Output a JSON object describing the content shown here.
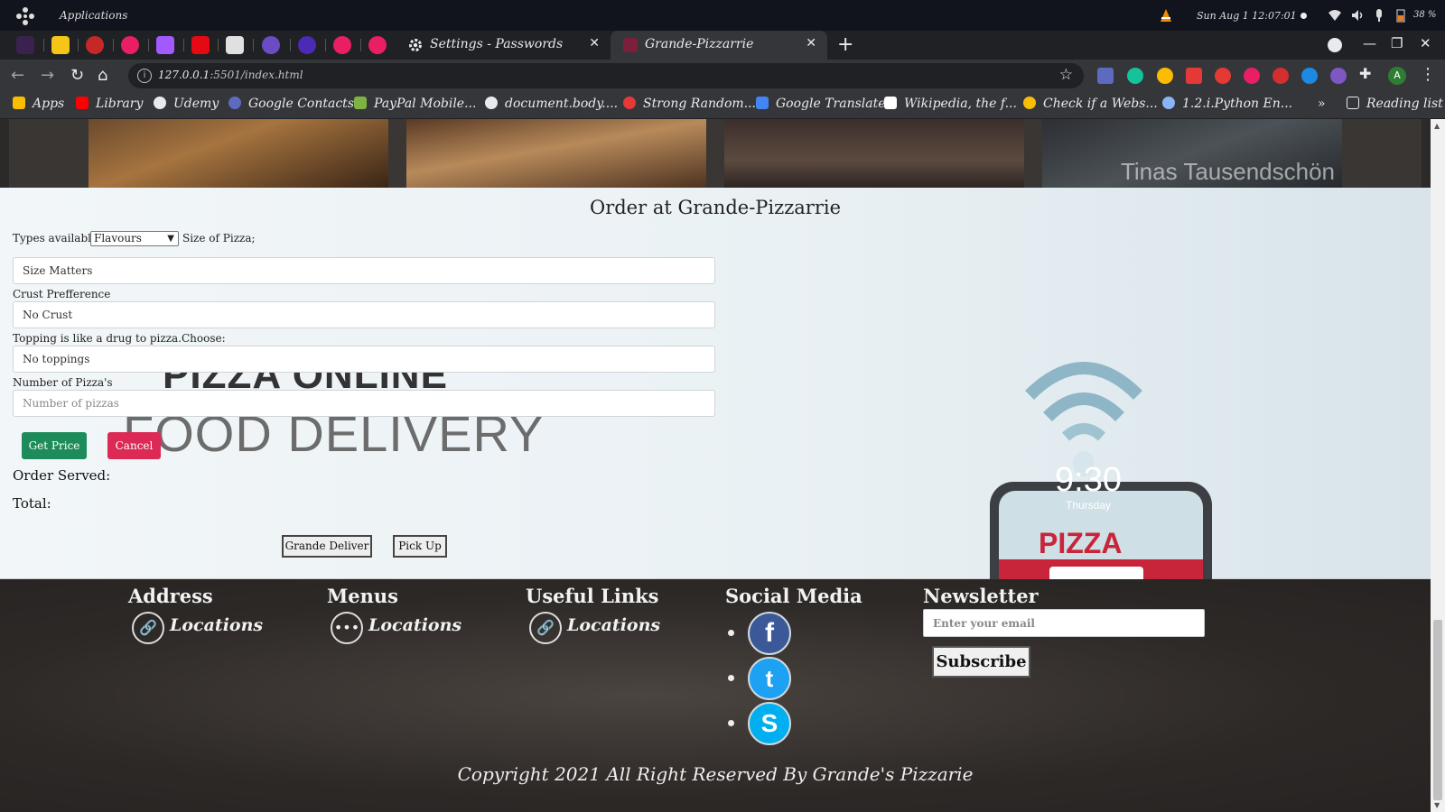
{
  "os": {
    "applications_label": "Applications",
    "clock": "Sun Aug 1  12:07:01",
    "battery_pct": "38 %"
  },
  "browser": {
    "tabs": [
      {
        "title": "Settings - Passwords",
        "icon": "gear-icon"
      },
      {
        "title": "Grande-Pizzarrie",
        "icon": "site-favicon"
      }
    ],
    "url_host": "127.0.0.1",
    "url_path": ":5501/index.html",
    "profile_initial": "A",
    "bookmarks": [
      {
        "label": "Apps",
        "color": "#fbbc04"
      },
      {
        "label": "Library",
        "color": "#ff0000"
      },
      {
        "label": "Udemy",
        "color": "#e8eaed"
      },
      {
        "label": "Google Contacts",
        "color": "#5c6bc0"
      },
      {
        "label": "PayPal Mobile...",
        "color": "#7cb342"
      },
      {
        "label": "document.body....",
        "color": "#e8eaed"
      },
      {
        "label": "Strong Random...",
        "color": "#e53935"
      },
      {
        "label": "Google Translate",
        "color": "#4285f4"
      },
      {
        "label": "Wikipedia, the f...",
        "color": "#ffffff"
      },
      {
        "label": "Check if a Webs...",
        "color": "#fbbc04"
      },
      {
        "label": "1.2.i.Python En...",
        "color": "#8ab4f8"
      }
    ],
    "more_bookmarks": "»",
    "reading_list": "Reading list"
  },
  "gallery": {
    "watermark": "Tinas Tausendschön"
  },
  "order": {
    "title": "Order at Grande-Pizzarrie",
    "types_label": "Types available",
    "types_selected": "Flavours",
    "size_label": "Size of Pizza;",
    "size_value": "Size Matters",
    "crust_label": "Crust Prefference",
    "crust_value": "No Crust",
    "topping_label": "Topping is like a drug to pizza.Choose:",
    "topping_value": "No toppings",
    "count_label": "Number of Pizza's",
    "count_placeholder": "Number of pizzas",
    "get_price": "Get Price",
    "cancel": "Cancel",
    "served_label": "Order Served:",
    "total_label": "Total:",
    "deliver": "Grande Deliver",
    "pickup": "Pick Up",
    "bg_line1": "PIZZA ONLINE",
    "bg_line2": "FOOD DELIVERY",
    "phone_time": "9:30",
    "phone_day": "Thursday",
    "phone_pizza": "PIZZA"
  },
  "footer": {
    "address_heading": "Address",
    "menus_heading": "Menus",
    "links_heading": "Useful Links",
    "social_heading": "Social Media",
    "newsletter_heading": "Newsletter",
    "address_link": "Locations",
    "menus_link": "Locations",
    "links_link": "Locations",
    "social": [
      {
        "name": "facebook",
        "glyph": "f",
        "color": "#3b5998"
      },
      {
        "name": "twitter",
        "glyph": "t",
        "color": "#1da1f2"
      },
      {
        "name": "skype",
        "glyph": "S",
        "color": "#00aff0"
      }
    ],
    "email_placeholder": "Enter your email",
    "subscribe": "Subscribe",
    "copyright": "Copyright 2021 All Right Reserved By Grande's Pizzarie"
  }
}
